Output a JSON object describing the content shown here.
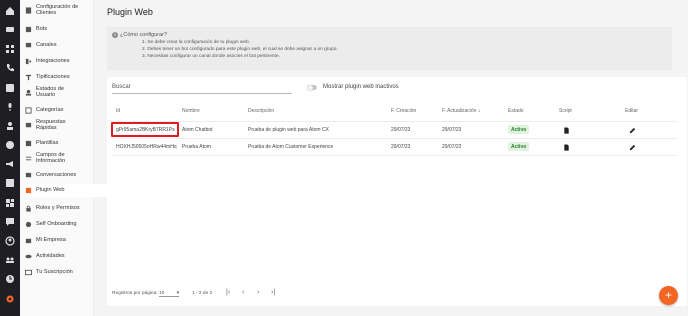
{
  "rail": {
    "icons": [
      "home-icon",
      "chat-icon",
      "grid-icon",
      "phone-icon",
      "contact-card-icon",
      "mic-icon",
      "user-off-icon",
      "whatsapp-icon",
      "campaign-icon",
      "list-icon",
      "apps-icon",
      "message-icon",
      "person-icon",
      "people-icon",
      "clock-icon",
      "settings-icon"
    ]
  },
  "sidebar": {
    "items": [
      {
        "label": "Configuración de Clientes",
        "icon": "document-icon"
      },
      {
        "label": "Bots",
        "icon": "bot-icon"
      },
      {
        "label": "Canales",
        "icon": "channel-icon"
      },
      {
        "label": "Integraciones",
        "icon": "integration-icon"
      },
      {
        "label": "Tipificaciones",
        "icon": "type-icon"
      },
      {
        "label": "Estados de Usuario",
        "icon": "user-status-icon"
      },
      {
        "label": "Categorías",
        "icon": "category-icon"
      },
      {
        "label": "Respuestas Rápidas",
        "icon": "quick-reply-icon"
      },
      {
        "label": "Plantillas",
        "icon": "template-icon"
      },
      {
        "label": "Campos de Información",
        "icon": "fields-icon"
      },
      {
        "label": "Conversaciones",
        "icon": "conversation-icon"
      },
      {
        "label": "Plugin Web",
        "icon": "plugin-icon"
      },
      {
        "label": "Roles y Permisos",
        "icon": "lock-icon"
      },
      {
        "label": "Self Onboarding",
        "icon": "onboarding-icon"
      },
      {
        "label": "Mi Empresa",
        "icon": "company-icon"
      },
      {
        "label": "Actividades",
        "icon": "eye-icon"
      },
      {
        "label": "Tu Suscripción",
        "icon": "card-icon"
      }
    ],
    "active_color": "#f26522"
  },
  "page": {
    "title": "Plugin Web",
    "info": {
      "title": "¿Cómo configurar?",
      "lines": [
        "1. Se debe crear la configuración de tu plugin web.",
        "2. Debes tener un bot configurado para este plugin web, el cual se debe asignar a un grupo.",
        "3. Necesitas configurar un canal donde asocies el bot pertinente."
      ]
    },
    "search_placeholder": "Buscar",
    "toggle_label": "Mostrar plugin web inactivos",
    "columns": [
      "Id",
      "Nombre",
      "Descripción",
      "F. Creación",
      "F. Actualización",
      "Estado",
      "Script",
      "Editar"
    ],
    "sort_arrow": "↓",
    "rows": [
      {
        "id": "gPr95ama2BKryB7RR1Ps",
        "name": "Atom Chatbot",
        "description": "Prueba de plugin web para Atom CX",
        "created": "29/07/23",
        "updated": "29/07/23",
        "status": "Activo"
      },
      {
        "id": "HOXHJ50505oHRw44mHoj",
        "name": "Prueba Atom",
        "description": "Prueba de Atom Customer Experience",
        "created": "29/07/23",
        "updated": "29/07/23",
        "status": "Activo"
      }
    ],
    "footer": {
      "rows_per_page_label": "Registros por página:",
      "rows_per_page_value": "10",
      "range": "1 - 2 de 2"
    },
    "fab_label": "+",
    "accent": "#f26522",
    "status_color": "#2a7d2e"
  }
}
